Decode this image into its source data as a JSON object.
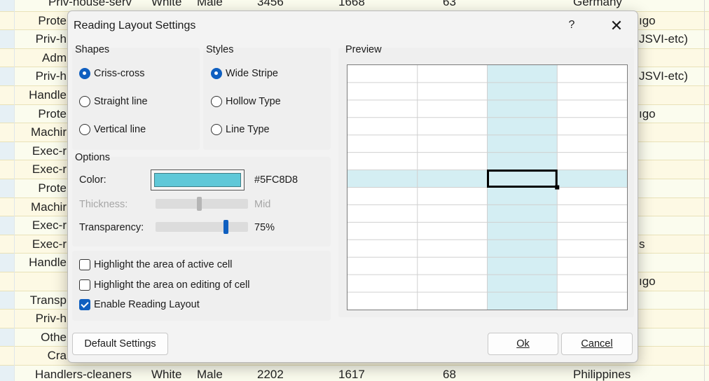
{
  "dialog": {
    "title": "Reading Layout Settings",
    "help_label": "?",
    "close_label": "✕",
    "shapes": {
      "label": "Shapes",
      "options": [
        "Criss-cross",
        "Straight line",
        "Vertical line"
      ],
      "selected": 0
    },
    "styles": {
      "label": "Styles",
      "options": [
        "Wide Stripe",
        "Hollow Type",
        "Line Type"
      ],
      "selected": 0
    },
    "options": {
      "label": "Options",
      "color_label": "Color:",
      "color_value": "#5FC8D8",
      "thickness_label": "Thickness:",
      "thickness_value": "Mid",
      "thickness_level": 0.5,
      "transparency_label": "Transparency:",
      "transparency_value": "75%",
      "transparency_level": 0.75
    },
    "checks": [
      {
        "label": "Highlight the area of active cell",
        "checked": false
      },
      {
        "label": "Highlight the area on editing of cell",
        "checked": false
      },
      {
        "label": "Enable Reading Layout",
        "checked": true
      }
    ],
    "preview_label": "Preview",
    "default_button": "Default Settings",
    "ok_button": "Ok",
    "cancel_button": "Cancel",
    "preview_grid": {
      "rows": 14,
      "cols": 4,
      "active_row": 6,
      "active_col": 2
    }
  },
  "sheet": {
    "top_row": [
      "Priv-house-serv",
      "White",
      "Male",
      "3456",
      "1668",
      "63",
      "Germany"
    ],
    "left_col": [
      "Prote",
      "Priv-h",
      "Adm",
      "Priv-h",
      "Handle",
      "Prote",
      "Machir",
      "Exec-r",
      "Exec-r",
      "Prote",
      "Machir",
      "Exec-r",
      "Exec-r",
      "Handle",
      "",
      "Transp",
      "Priv-h",
      "Othe",
      "Cra"
    ],
    "right_col": [
      "ıgo",
      "JSVI-etc)",
      "",
      "JSVI-etc)",
      "",
      "ıgo",
      "",
      "",
      "",
      "",
      "",
      "",
      "s",
      "",
      "ıgo",
      "",
      "",
      "",
      ""
    ],
    "bottom_row": [
      "Handlers-cleaners",
      "White",
      "Male",
      "2202",
      "1617",
      "68",
      "Philippines"
    ]
  },
  "colors": {
    "accent": "#0F5FC0",
    "highlight": "#5FC8D8",
    "highlight_preview": "#D4EEF3"
  }
}
